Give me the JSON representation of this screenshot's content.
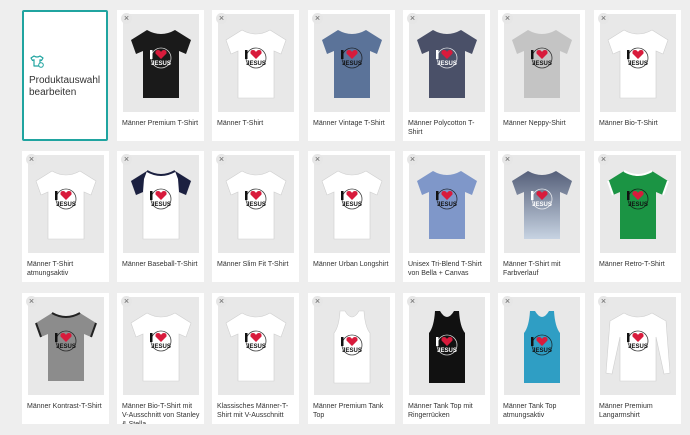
{
  "edit_card": {
    "label": "Produktauswahl bearbeiten",
    "icon": "shirt-edit-icon"
  },
  "remove_symbol": "×",
  "print_text": "JESUS",
  "products": [
    {
      "name": "Männer Premium T-Shirt",
      "color": "#1a1a1a",
      "style": "tee"
    },
    {
      "name": "Männer T-Shirt",
      "color": "#ffffff",
      "style": "tee"
    },
    {
      "name": "Männer Vintage T-Shirt",
      "color": "#5b7399",
      "style": "tee"
    },
    {
      "name": "Männer Polycotton T-Shirt",
      "color": "#4a5068",
      "style": "tee"
    },
    {
      "name": "Männer Neppy-Shirt",
      "color": "#c4c4c4",
      "style": "tee"
    },
    {
      "name": "Männer Bio-T-Shirt",
      "color": "#ffffff",
      "style": "tee"
    },
    {
      "name": "Männer T-Shirt atmungsaktiv",
      "color": "#ffffff",
      "style": "tee"
    },
    {
      "name": "Männer Baseball-T-Shirt",
      "color": "#ffffff",
      "style": "baseball",
      "accent": "#1b2040"
    },
    {
      "name": "Männer Slim Fit T-Shirt",
      "color": "#ffffff",
      "style": "tee"
    },
    {
      "name": "Männer Urban Longshirt",
      "color": "#ffffff",
      "style": "tee"
    },
    {
      "name": "Unisex Tri-Blend T-Shirt von Bella + Canvas",
      "color": "#7f97c9",
      "style": "tee"
    },
    {
      "name": "Männer T-Shirt mit Farbverlauf",
      "color": "#56607a",
      "style": "gradient"
    },
    {
      "name": "Männer Retro-T-Shirt",
      "color": "#1b9444",
      "style": "ringer",
      "accent": "#ffffff"
    },
    {
      "name": "Männer Kontrast-T-Shirt",
      "color": "#8c8c8c",
      "style": "ringer",
      "accent": "#222222"
    },
    {
      "name": "Männer Bio-T-Shirt mit V-Ausschnitt von Stanley & Stella",
      "color": "#ffffff",
      "style": "tee"
    },
    {
      "name": "Klassisches Männer-T-Shirt mit V-Ausschnitt",
      "color": "#ffffff",
      "style": "tee"
    },
    {
      "name": "Männer Premium Tank Top",
      "color": "#ffffff",
      "style": "tank"
    },
    {
      "name": "Männer Tank Top mit Ringerrücken",
      "color": "#111111",
      "style": "tank"
    },
    {
      "name": "Männer Tank Top atmungsaktiv",
      "color": "#2f9ec4",
      "style": "tank"
    },
    {
      "name": "Männer Premium Langarmshirt",
      "color": "#ffffff",
      "style": "longsleeve"
    }
  ]
}
